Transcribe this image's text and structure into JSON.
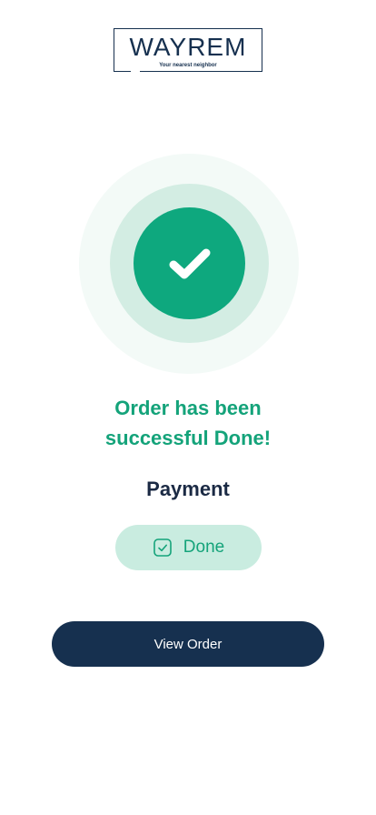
{
  "logo": {
    "wordmark": "WAYREM",
    "tagline": "Your nearest neighbor"
  },
  "success": {
    "icon": "checkmark-icon",
    "title_line1": "Order has been",
    "title_line2": "successful Done!"
  },
  "payment": {
    "label": "Payment",
    "status": {
      "icon": "check-square-icon",
      "text": "Done"
    }
  },
  "actions": {
    "view_order_label": "View Order"
  },
  "colors": {
    "brand_navy": "#16304f",
    "success_green": "#0ea87e",
    "pill_bg": "#c9ece0",
    "ring_light": "#f3faf7",
    "ring_mid": "#d3ede3"
  }
}
